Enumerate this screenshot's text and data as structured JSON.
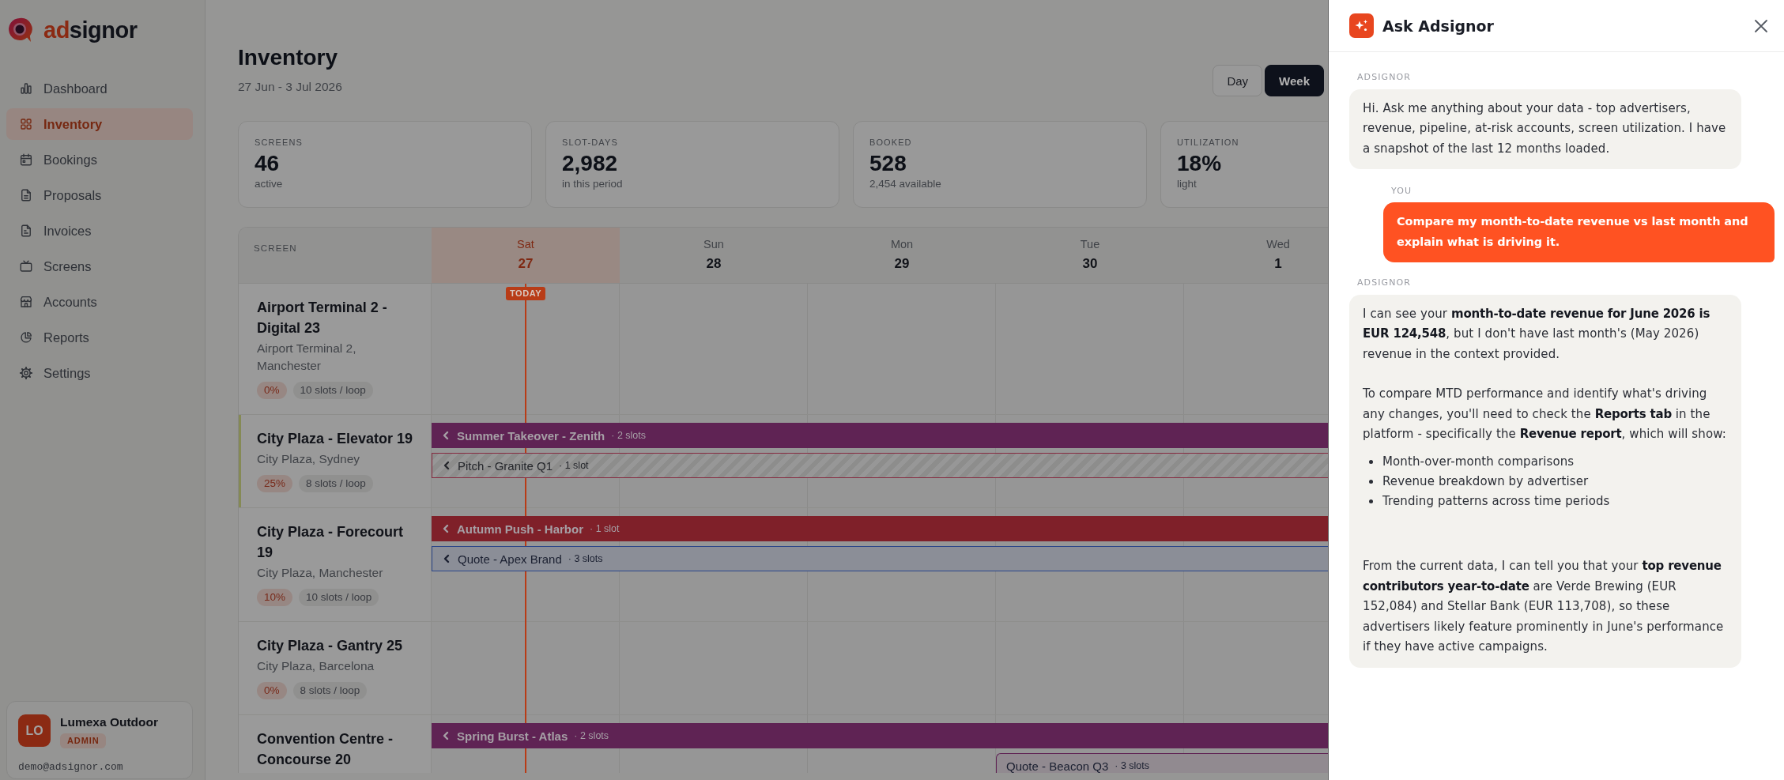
{
  "sidebar": {
    "logo": {
      "accent": "ad",
      "text": "signor"
    },
    "nav": [
      {
        "label": "Dashboard",
        "selected": false
      },
      {
        "label": "Inventory",
        "selected": true
      },
      {
        "label": "Bookings",
        "selected": false
      },
      {
        "label": "Proposals",
        "selected": false
      },
      {
        "label": "Invoices",
        "selected": false
      },
      {
        "label": "Screens",
        "selected": false
      },
      {
        "label": "Accounts",
        "selected": false
      },
      {
        "label": "Reports",
        "selected": false
      },
      {
        "label": "Settings",
        "selected": false
      }
    ],
    "account": {
      "initials": "LO",
      "name": "Lumexa Outdoor",
      "role": "ADMIN",
      "email": "demo@adsignor.com"
    }
  },
  "header": {
    "title": "Inventory",
    "date_range": "27 Jun - 3 Jul 2026",
    "view_toggle": [
      {
        "label": "Day",
        "selected": false
      },
      {
        "label": "Week",
        "selected": true
      }
    ]
  },
  "stats": [
    {
      "label": "SCREENS",
      "value": "46",
      "note": "active"
    },
    {
      "label": "SLOT-DAYS",
      "value": "2,982",
      "note": "in this period"
    },
    {
      "label": "BOOKED",
      "value": "528",
      "note": "2,454 available"
    },
    {
      "label": "UTILIZATION",
      "value": "18%",
      "note": "light"
    }
  ],
  "schedule": {
    "screen_header": "SCREEN",
    "today_badge": "TODAY",
    "days": [
      {
        "name": "Sat",
        "date": "27",
        "today": true
      },
      {
        "name": "Sun",
        "date": "28",
        "today": false
      },
      {
        "name": "Mon",
        "date": "29",
        "today": false
      },
      {
        "name": "Tue",
        "date": "30",
        "today": false
      },
      {
        "name": "Wed",
        "date": "1",
        "today": false
      }
    ],
    "rows": [
      {
        "name": "Airport Terminal 2 - Digital 23",
        "location": "Airport Terminal 2, Manchester",
        "utilization": "0%",
        "capacity": "10 slots / loop",
        "selected": false
      },
      {
        "name": "City Plaza - Elevator 19",
        "location": "City Plaza, Sydney",
        "utilization": "25%",
        "capacity": "8 slots / loop",
        "selected": true,
        "tracks": [
          [
            {
              "kind": "booked",
              "title": "Summer Takeover - Zenith",
              "slots": "· 2 slots",
              "color": "#5f2354",
              "continues_before": true
            }
          ],
          [
            {
              "kind": "pitch",
              "title": "Pitch - Granite Q1",
              "slots": "· 1 slot",
              "color": "#862a40",
              "continues_before": true
            }
          ]
        ]
      },
      {
        "name": "City Plaza - Forecourt 19",
        "location": "City Plaza, Manchester",
        "utilization": "10%",
        "capacity": "10 slots / loop",
        "selected": false,
        "tracks": [
          [
            {
              "kind": "booked",
              "title": "Autumn Push - Harbor",
              "slots": "· 1 slot",
              "color": "#7f2029",
              "continues_before": true
            }
          ],
          [
            {
              "kind": "quote",
              "title": "Quote - Apex Brand",
              "slots": "· 3 slots",
              "color": "#2a4589",
              "continues_before": true
            }
          ]
        ]
      },
      {
        "name": "City Plaza - Gantry 25",
        "location": "City Plaza, Barcelona",
        "utilization": "0%",
        "capacity": "8 slots / loop",
        "selected": false
      },
      {
        "name": "Convention Centre - Concourse 20",
        "selected": false,
        "tracks": [
          [
            {
              "kind": "booked",
              "title": "Spring Burst - Atlas",
              "slots": "· 2 slots",
              "color": "#5f2354",
              "continues_before": true
            }
          ],
          [
            {
              "kind": "empty"
            },
            {
              "kind": "empty"
            },
            {
              "kind": "empty"
            },
            {
              "kind": "quote",
              "title": "Quote - Beacon Q3",
              "slots": "· 3 slots",
              "color": "#5f2354",
              "continues_before": false
            }
          ]
        ]
      }
    ]
  },
  "assistant": {
    "title": "Ask Adsignor",
    "messages": [
      {
        "kind": "assistant",
        "sender": "ADSIGNOR",
        "blocks": [
          {
            "kind": "paragraph",
            "text": "Hi. Ask me anything about your data - top advertisers, revenue, pipeline, at-risk accounts, screen utilization. I have a snapshot of the last 12 months loaded."
          }
        ]
      },
      {
        "kind": "user",
        "sender": "YOU",
        "blocks": [
          {
            "kind": "paragraph",
            "text": "Compare my month-to-date revenue vs last month and explain what is driving it."
          }
        ]
      },
      {
        "kind": "assistant",
        "sender": "ADSIGNOR",
        "blocks": [
          {
            "kind": "paragraph",
            "text": "I can see your **month-to-date revenue for June 2026 is EUR 124,548**, but I don't have last month's (May 2026) revenue in the context provided."
          },
          {
            "kind": "paragraph",
            "text": "To compare MTD performance and identify what's driving any changes, you'll need to check the **Reports tab** in the platform - specifically the **Revenue report**, which will show:"
          },
          {
            "kind": "list",
            "items": [
              "Month-over-month comparisons",
              "Revenue breakdown by advertiser",
              "Trending patterns across time periods"
            ]
          },
          {
            "kind": "paragraph",
            "text": "From the current data, I can tell you that your **top revenue contributors year-to-date** are Verde Brewing (EUR 152,084) and Stellar Bank (EUR 113,708), so these advertisers likely feature prominently in June's performance if they have active campaigns."
          }
        ]
      }
    ]
  }
}
